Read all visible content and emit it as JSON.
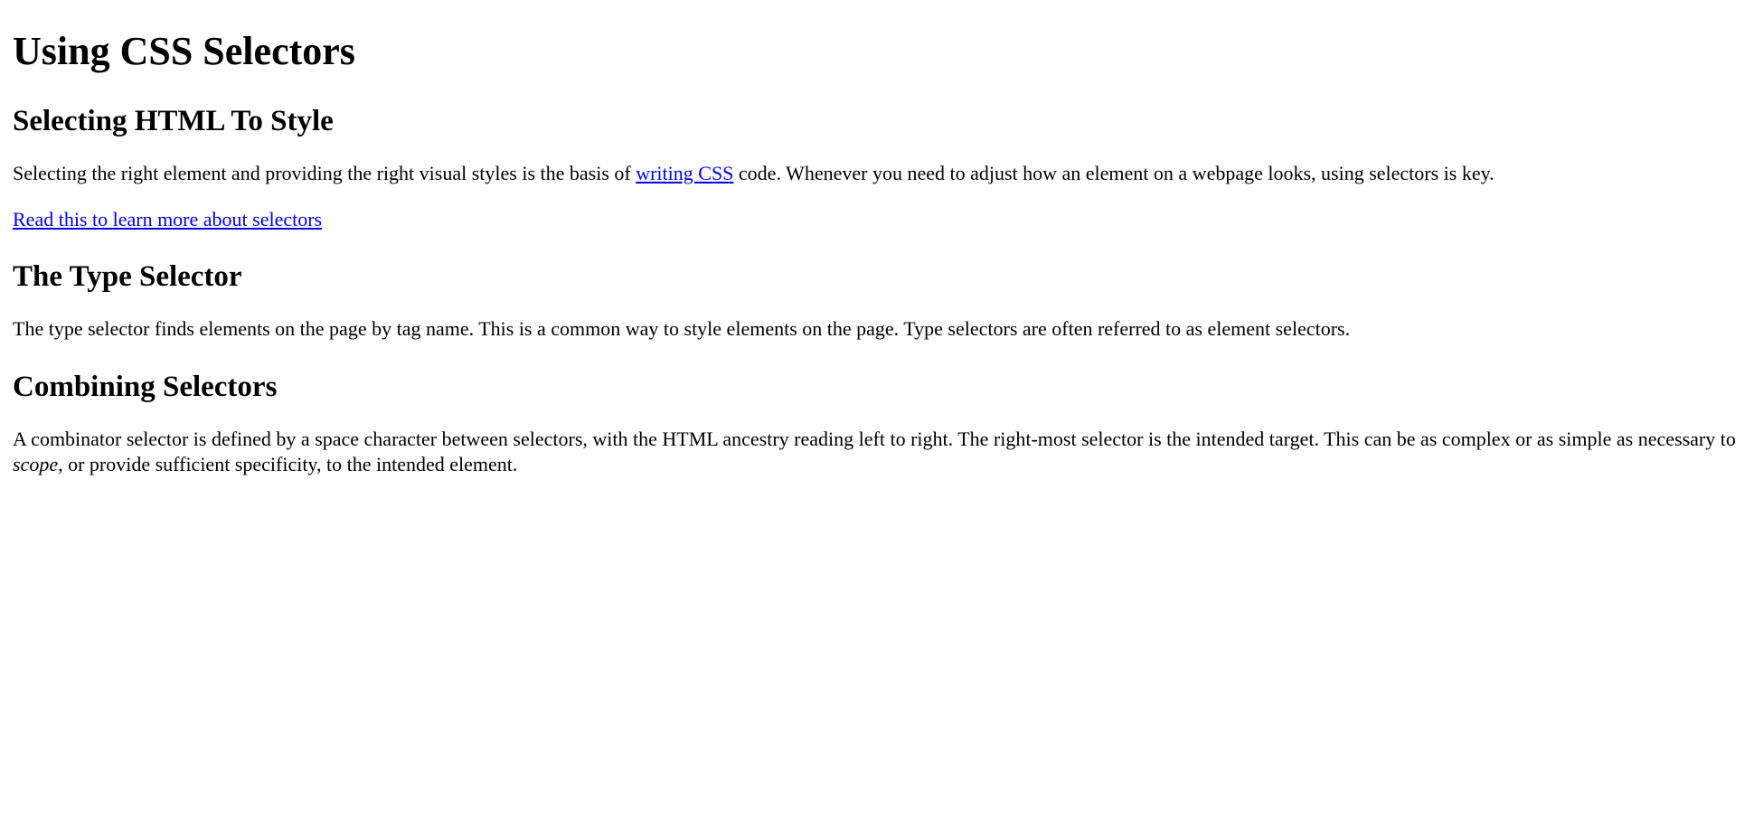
{
  "title": "Using CSS Selectors",
  "sections": {
    "intro": {
      "heading": "Selecting HTML To Style",
      "p1_before": "Selecting the right element and providing the right visual styles is the basis of ",
      "p1_link": "writing CSS",
      "p1_after": " code. Whenever you need to adjust how an element on a webpage looks, using selectors is key.",
      "p2_link": "Read this to learn more about selectors"
    },
    "type": {
      "heading": "The Type Selector",
      "p1": "The type selector finds elements on the page by tag name. This is a common way to style elements on the page. Type selectors are often referred to as element selectors."
    },
    "combining": {
      "heading": "Combining Selectors",
      "p1_before": "A combinator selector is defined by a space character between selectors, with the HTML ancestry reading left to right. The right-most selector is the intended target. This can be as complex or as simple as necessary to ",
      "p1_em": "scope",
      "p1_after": ", or provide sufficient specificity, to the intended element."
    }
  }
}
